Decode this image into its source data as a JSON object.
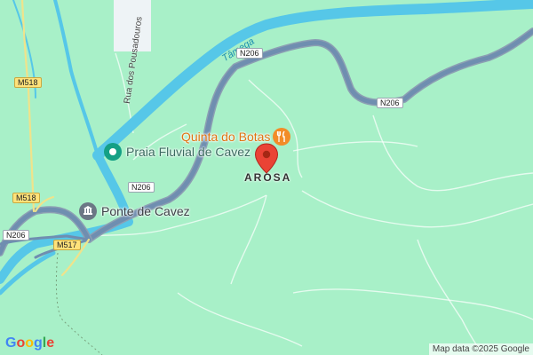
{
  "map": {
    "river_label": "Tâmega",
    "street_label": "Rua dos Pousadouros",
    "place_label": "AROSA",
    "pois": [
      {
        "name": "Quinta do Botas",
        "icon": "restaurant-icon",
        "color": "#f28c28"
      },
      {
        "name": "Praia Fluvial de Cavez",
        "icon": "beach-pin-icon",
        "color": "#14a085"
      },
      {
        "name": "Ponte de Cavez",
        "icon": "landmark-icon",
        "color": "#6b7785"
      }
    ],
    "road_labels": {
      "n206_a": "N206",
      "n206_b": "N206",
      "n206_c": "N206",
      "n206_d": "N206",
      "m518_a": "M518",
      "m518_b": "M518",
      "m517": "M517"
    },
    "marker": {
      "icon": "location-pin-icon",
      "color": "#ea4335"
    },
    "colors": {
      "land": "#a8f0c8",
      "water": "#56c7e8",
      "road": "#6f8eb0"
    }
  },
  "footer": {
    "logo_text": "Google",
    "attribution": "Map data ©2025 Google"
  }
}
